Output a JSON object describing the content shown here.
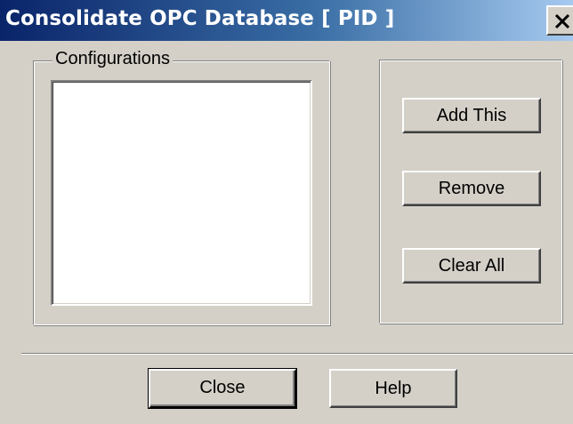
{
  "window": {
    "title": "Consolidate OPC Database [ PID ]"
  },
  "configurations": {
    "group_label": "Configurations",
    "items": []
  },
  "actions": {
    "add_label": "Add This",
    "remove_label": "Remove",
    "clear_label": "Clear All"
  },
  "footer": {
    "close_label": "Close",
    "help_label": "Help"
  },
  "icons": {
    "close": "close-icon"
  },
  "colors": {
    "titlebar_start": "#0a246a",
    "titlebar_end": "#a6caf0",
    "dialog_face": "#d4d0c8"
  }
}
